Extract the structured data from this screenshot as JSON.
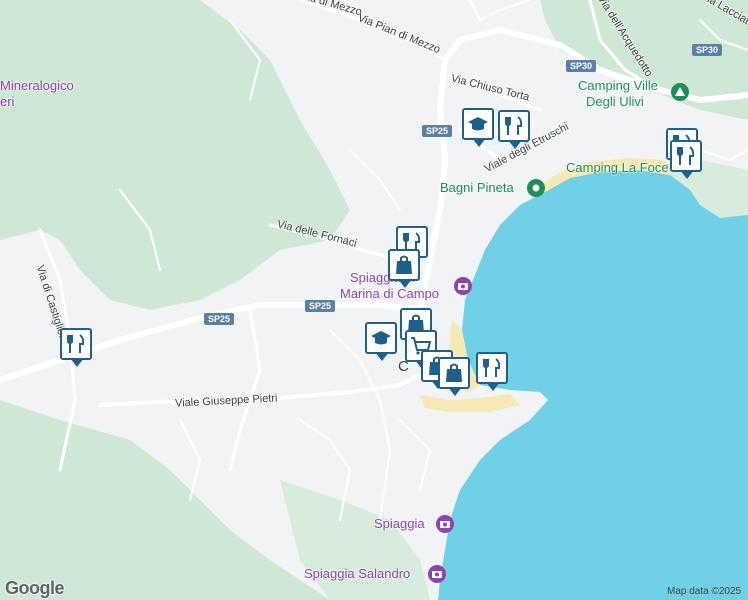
{
  "map": {
    "colors": {
      "land": "#f1f3f4",
      "forest": "#cfe8d5",
      "water": "#6fd0e6",
      "beach": "#f7e9b5",
      "road": "#ffffff",
      "shield": "#5b7fa6",
      "marker": "#1f5f8b"
    },
    "road_labels": {
      "via_di_mezzo": "Via di Mezzo",
      "via_pian_di_mezzo": "Via Pian di Mezzo",
      "via_chiuso_torta": "Via Chiuso Torta",
      "via_etruschi": "Viale degli Etruschi",
      "via_fornaci": "Via delle Fornaci",
      "via_castiglione": "Via di Castiglione",
      "viale_pietri": "Viale Giuseppe Pietri",
      "via_acquedotto": "Via dell'Acquedotto",
      "via_lacciata": "Via Lacciata",
      "sp25_a": "SP25",
      "sp25_b": "SP25",
      "sp25_c": "SP25",
      "sp30_a": "SP30",
      "sp30_b": "SP30"
    },
    "place_labels": {
      "museo_line1": "Mineralogico",
      "museo_line2": "eri",
      "camping_ville_line1": "Camping Ville",
      "camping_ville_line2": "Degli Ulivi",
      "bagni_pineta": "Bagni Pineta",
      "camping_foce": "Camping La Foce",
      "spiaggia_line1": "Spiaggia di",
      "spiaggia_line2": "Marina di Campo",
      "spiaggia": "Spiaggia",
      "spiaggia_salandro": "Spiaggia Salandro",
      "town_fragment": "C"
    },
    "markers": [
      {
        "icon": "school-icon"
      },
      {
        "icon": "restaurant-icon"
      },
      {
        "icon": "restaurant-icon"
      },
      {
        "icon": "restaurant-icon"
      },
      {
        "icon": "restaurant-icon"
      },
      {
        "icon": "shopping-bag-icon"
      },
      {
        "icon": "shopping-bag-icon"
      },
      {
        "icon": "school-icon"
      },
      {
        "icon": "shopping-cart-icon"
      },
      {
        "icon": "shopping-bag-icon"
      },
      {
        "icon": "shopping-bag-icon"
      },
      {
        "icon": "restaurant-icon"
      },
      {
        "icon": "restaurant-icon"
      }
    ],
    "attribution": "Map data ©2025",
    "logo": "Google"
  }
}
